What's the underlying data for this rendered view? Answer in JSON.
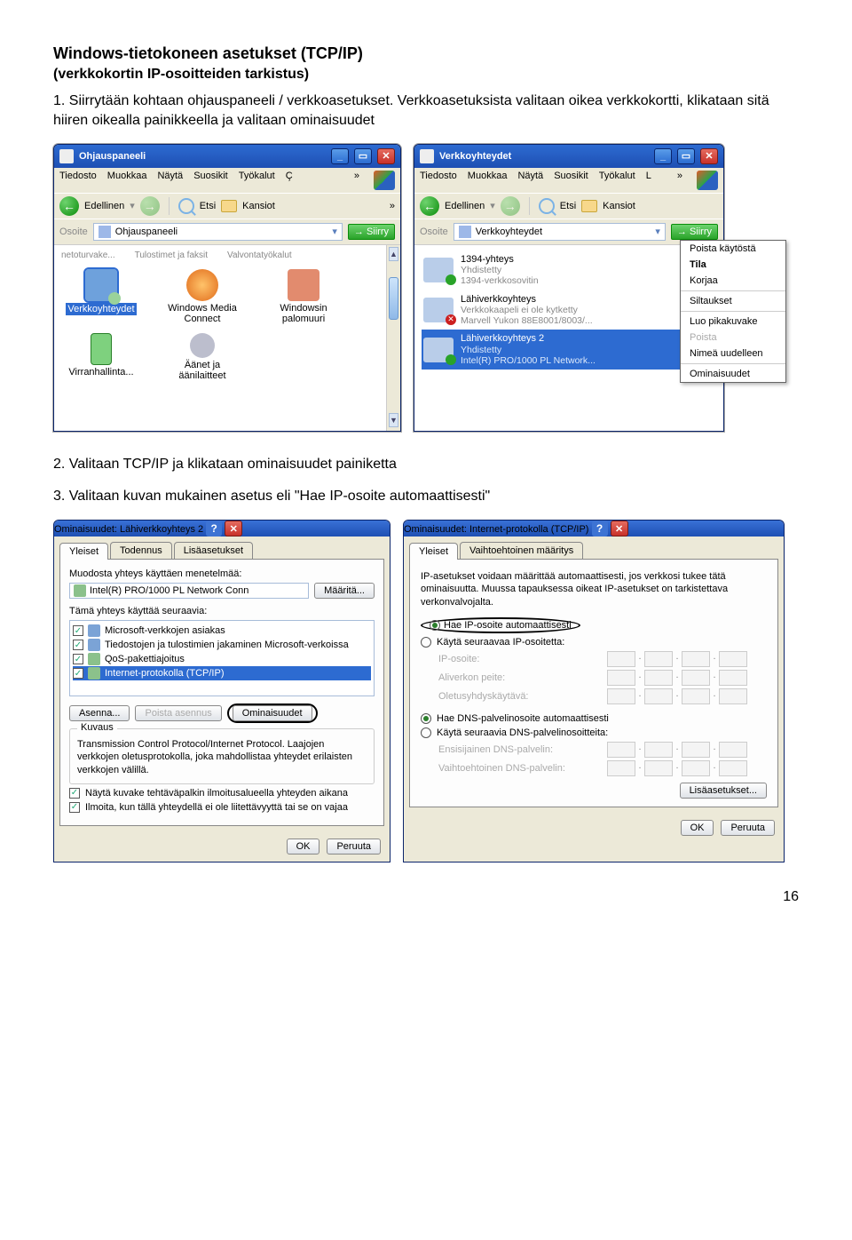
{
  "title": "Windows-tietokoneen asetukset (TCP/IP)",
  "subtitle": "(verkkokortin IP-osoitteiden tarkistus)",
  "para1": "1. Siirrytään kohtaan ohjauspaneeli / verkkoasetukset. Verkkoasetuksista valitaan oikea verkkokortti, klikataan sitä hiiren oikealla painikkeella ja valitaan ominaisuudet",
  "para2": "2. Valitaan TCP/IP ja klikataan ominaisuudet painiketta",
  "para3": "3. Valitaan kuvan mukainen asetus eli \"Hae IP-osoite automaattisesti\"",
  "page_number": "16",
  "cpl": {
    "win_title": "Ohjauspaneeli",
    "menu": [
      "Tiedosto",
      "Muokkaa",
      "Näytä",
      "Suosikit",
      "Työkalut",
      "Ç"
    ],
    "menu_chev": "»",
    "tb_back": "Edellinen",
    "tb_search": "Etsi",
    "tb_folders": "Kansiot",
    "tb_more": "»",
    "addr_label": "Osoite",
    "addr_value": "Ohjauspaneeli",
    "addr_go": "Siirry",
    "row0": [
      "netoturvake...",
      "Tulostimet ja faksit",
      "Valvontatyökalut"
    ],
    "row1": [
      "Verkkoyhteydet",
      "Windows Media Connect",
      "Windowsin palomuuri"
    ],
    "row2": [
      "Virranhallinta...",
      "Äänet ja äänilaitteet"
    ]
  },
  "net": {
    "win_title": "Verkkoyhteydet",
    "menu": [
      "Tiedosto",
      "Muokkaa",
      "Näytä",
      "Suosikit",
      "Työkalut",
      "L"
    ],
    "menu_chev": "»",
    "tb_back": "Edellinen",
    "tb_search": "Etsi",
    "tb_folders": "Kansiot",
    "addr_label": "Osoite",
    "addr_value": "Verkkoyhteydet",
    "addr_go": "Siirry",
    "items": [
      {
        "name": "1394-yhteys",
        "sub1": "Yhdistetty",
        "sub2": "1394-verkkosovitin"
      },
      {
        "name": "Lähiverkkoyhteys",
        "sub1": "Verkkokaapeli ei ole kytketty",
        "sub2": "Marvell Yukon 88E8001/8003/..."
      },
      {
        "name": "Lähiverkkoyhteys 2",
        "sub1": "Yhdistetty",
        "sub2": "Intel(R) PRO/1000 PL Network..."
      }
    ],
    "context_menu": [
      "Poista käytöstä",
      "Tila",
      "Korjaa",
      "—",
      "Siltaukset",
      "—",
      "Luo pikakuvake",
      "Poista",
      "Nimeä uudelleen",
      "—",
      "Ominaisuudet"
    ]
  },
  "lan_props": {
    "win_title": "Ominaisuudet: Lähiverkkoyhteys 2",
    "tabs": [
      "Yleiset",
      "Todennus",
      "Lisäasetukset"
    ],
    "connect_label": "Muodosta yhteys käyttäen menetelmää:",
    "adapter": "Intel(R) PRO/1000 PL Network Conn",
    "configure_btn": "Määritä...",
    "uses_label": "Tämä yhteys käyttää seuraavia:",
    "components": [
      "Microsoft-verkkojen asiakas",
      "Tiedostojen ja tulostimien jakaminen Microsoft-verkoissa",
      "QoS-pakettiajoitus",
      "Internet-protokolla (TCP/IP)"
    ],
    "install_btn": "Asenna...",
    "uninstall_btn": "Poista asennus",
    "props_btn": "Ominaisuudet",
    "desc_group": "Kuvaus",
    "desc_text": "Transmission Control Protocol/Internet Protocol. Laajojen verkkojen oletusprotokolla, joka mahdollistaa yhteydet erilaisten verkkojen välillä.",
    "chk1": "Näytä kuvake tehtäväpalkin ilmoitusalueella yhteyden aikana",
    "chk2": "Ilmoita, kun tällä yhteydellä ei ole liitettävyyttä tai se on vajaa",
    "ok": "OK",
    "cancel": "Peruuta"
  },
  "tcpip": {
    "win_title": "Ominaisuudet: Internet-protokolla (TCP/IP)",
    "tabs": [
      "Yleiset",
      "Vaihtoehtoinen määritys"
    ],
    "intro": "IP-asetukset voidaan määrittää automaattisesti, jos verkkosi tukee tätä ominaisuutta. Muussa tapauksessa oikeat IP-asetukset on tarkistettava verkonvalvojalta.",
    "r_auto_ip": "Hae IP-osoite automaattisesti",
    "r_manual_ip": "Käytä seuraavaa IP-osoitetta:",
    "ip_labels": [
      "IP-osoite:",
      "Aliverkon peite:",
      "Oletusyhdyskäytävä:"
    ],
    "r_auto_dns": "Hae DNS-palvelinosoite automaattisesti",
    "r_manual_dns": "Käytä seuraavia DNS-palvelinosoitteita:",
    "dns_labels": [
      "Ensisijainen DNS-palvelin:",
      "Vaihtoehtoinen DNS-palvelin:"
    ],
    "adv_btn": "Lisäasetukset...",
    "ok": "OK",
    "cancel": "Peruuta"
  }
}
